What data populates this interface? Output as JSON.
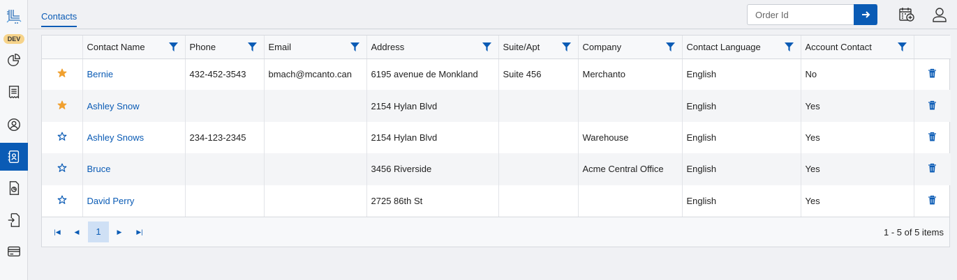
{
  "app": {
    "env_badge": "DEV",
    "accent": "#0a5bb5",
    "star_filled_color": "#f0a030"
  },
  "sidebar": {
    "items": [
      {
        "name": "dashboard",
        "icon": "pie-chart-icon",
        "active": false
      },
      {
        "name": "orders",
        "icon": "receipt-icon",
        "active": false
      },
      {
        "name": "profile",
        "icon": "user-circle-icon",
        "active": false
      },
      {
        "name": "contacts",
        "icon": "contact-book-icon",
        "active": true
      },
      {
        "name": "reports",
        "icon": "document-chart-icon",
        "active": false
      },
      {
        "name": "import",
        "icon": "document-import-icon",
        "active": false
      },
      {
        "name": "billing",
        "icon": "credit-card-icon",
        "active": false
      }
    ]
  },
  "header": {
    "tab_label": "Contacts",
    "order_search_placeholder": "Order Id",
    "go_icon": "arrow-right-icon",
    "add_schedule_icon": "calendar-add-icon",
    "user_icon": "user-icon"
  },
  "table": {
    "columns": [
      "Contact Name",
      "Phone",
      "Email",
      "Address",
      "Suite/Apt",
      "Company",
      "Contact Language",
      "Account Contact"
    ],
    "rows": [
      {
        "favorite": true,
        "name": "Bernie",
        "phone": "432-452-3543",
        "email": "bmach@mcanto.can",
        "address": "6195 avenue de Monkland",
        "suite": "Suite 456",
        "company": "Merchanto",
        "language": "English",
        "account": "No"
      },
      {
        "favorite": true,
        "name": "Ashley Snow",
        "phone": "",
        "email": "",
        "address": "2154 Hylan Blvd",
        "suite": "",
        "company": "",
        "language": "English",
        "account": "Yes"
      },
      {
        "favorite": false,
        "name": "Ashley Snows",
        "phone": "234-123-2345",
        "email": "",
        "address": "2154 Hylan Blvd",
        "suite": "",
        "company": "Warehouse",
        "language": "English",
        "account": "Yes"
      },
      {
        "favorite": false,
        "name": "Bruce",
        "phone": "",
        "email": "",
        "address": "3456 Riverside",
        "suite": "",
        "company": "Acme Central Office",
        "language": "English",
        "account": "Yes"
      },
      {
        "favorite": false,
        "name": "David Perry",
        "phone": "",
        "email": "",
        "address": "2725 86th St",
        "suite": "",
        "company": "",
        "language": "English",
        "account": "Yes"
      }
    ]
  },
  "pager": {
    "current_page": "1",
    "summary": "1 - 5 of 5 items"
  }
}
